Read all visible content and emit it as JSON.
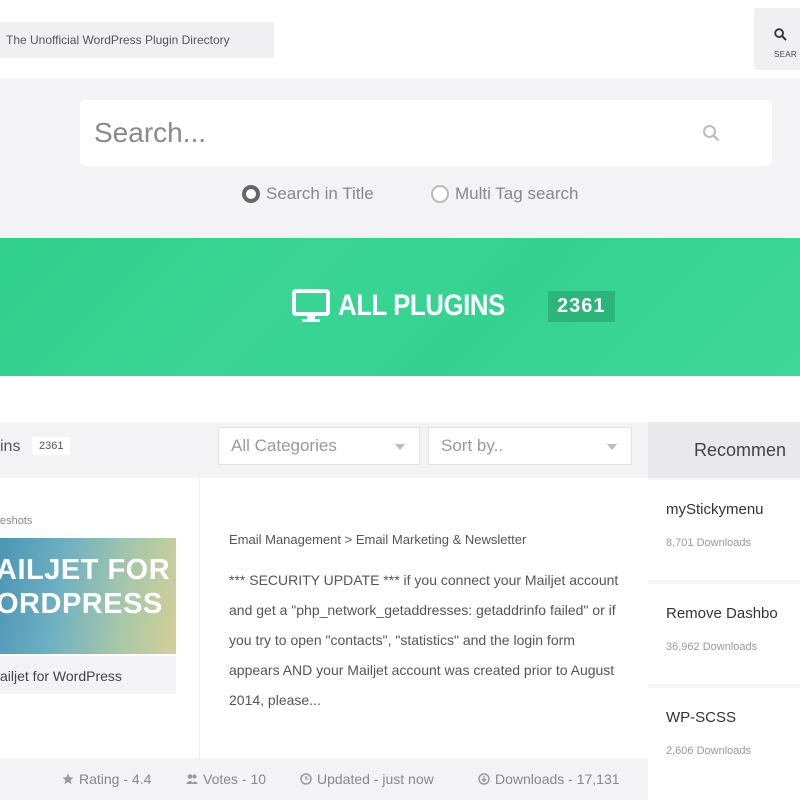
{
  "header": {
    "site_title": "The Unofficial WordPress Plugin Directory",
    "search_button_label": "SEAR"
  },
  "search": {
    "placeholder": "Search...",
    "options": [
      {
        "label": "Search in Title",
        "selected": true
      },
      {
        "label": "Multi Tag search",
        "selected": false
      }
    ]
  },
  "hero": {
    "title": "ALL PLUGINS",
    "count": "2361",
    "icon": "monitor-icon"
  },
  "listing": {
    "label": "ins",
    "count": "2361",
    "category_select": "All Categories",
    "sort_select": "Sort by.."
  },
  "plugin": {
    "screenshots_label": "eshots",
    "thumb_line1": "AILJET FOR",
    "thumb_line2": "ORDPRESS",
    "name": "ailjet for WordPress",
    "breadcrumb": "Email Management > Email Marketing & Newsletter",
    "description": "*** SECURITY UPDATE *** if you connect your Mailjet account and get a \"php_network_getaddresses: getaddrinfo failed\" or if you try to open \"contacts\", \"statistics\" and the login form appears AND your Mailjet account was created prior to August 2014, please...",
    "stats": {
      "rating": "Rating - 4.4",
      "votes": "Votes - 10",
      "updated": "Updated - just now",
      "downloads": "Downloads - 17,131"
    }
  },
  "sidebar": {
    "title": "Recommen",
    "items": [
      {
        "name": "myStickymenu",
        "downloads": "8,701 Downloads"
      },
      {
        "name": "Remove Dashbo",
        "downloads": "36,962 Downloads"
      },
      {
        "name": "WP-SCSS",
        "downloads": "2,606 Downloads"
      }
    ]
  },
  "colors": {
    "accent_green": "#34d292",
    "badge_green": "#2cb57b",
    "background": "#f3f2f4"
  }
}
